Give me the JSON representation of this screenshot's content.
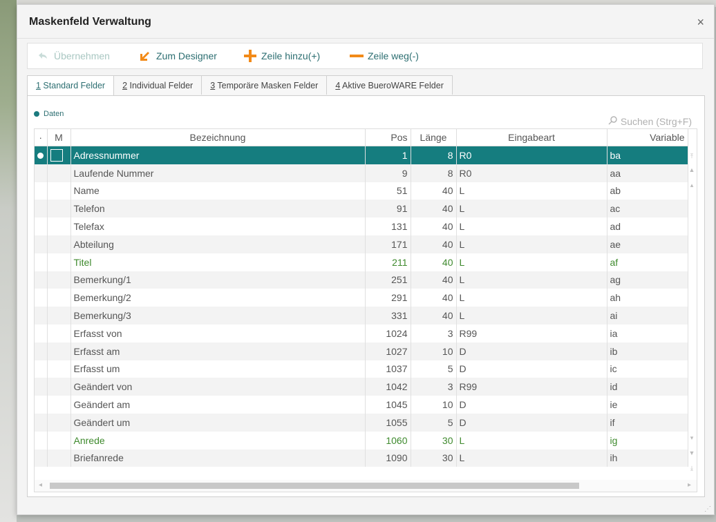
{
  "dialog": {
    "title": "Maskenfeld Verwaltung",
    "close_label": "×"
  },
  "toolbar": {
    "uebernehmen": "Übernehmen",
    "zum_designer": "Zum Designer",
    "zeile_hinzu": "Zeile hinzu(+)",
    "zeile_weg": "Zeile weg(-)"
  },
  "tabs": [
    {
      "num": "1",
      "label": " Standard Felder"
    },
    {
      "num": "2",
      "label": " Individual Felder"
    },
    {
      "num": "3",
      "label": " Temporäre Masken Felder"
    },
    {
      "num": "4",
      "label": " Aktive BueroWARE Felder"
    }
  ],
  "section_label": "Daten",
  "search_label": "Suchen (Strg+F)",
  "columns": {
    "dot": "·",
    "m": "M",
    "bezeichnung": "Bezeichnung",
    "pos": "Pos",
    "laenge": "Länge",
    "eingabeart": "Eingabeart",
    "variable": "Variable"
  },
  "rows": [
    {
      "bezeichnung": "Adressnummer",
      "pos": "1",
      "laenge": "8",
      "eingabeart": "R0",
      "variable": "ba",
      "selected": true
    },
    {
      "bezeichnung": "Laufende Nummer",
      "pos": "9",
      "laenge": "8",
      "eingabeart": "R0",
      "variable": "aa"
    },
    {
      "bezeichnung": "Name",
      "pos": "51",
      "laenge": "40",
      "eingabeart": "L",
      "variable": "ab"
    },
    {
      "bezeichnung": "Telefon",
      "pos": "91",
      "laenge": "40",
      "eingabeart": "L",
      "variable": "ac"
    },
    {
      "bezeichnung": "Telefax",
      "pos": "131",
      "laenge": "40",
      "eingabeart": "L",
      "variable": "ad"
    },
    {
      "bezeichnung": "Abteilung",
      "pos": "171",
      "laenge": "40",
      "eingabeart": "L",
      "variable": "ae"
    },
    {
      "bezeichnung": "Titel",
      "pos": "211",
      "laenge": "40",
      "eingabeart": "L",
      "variable": "af",
      "green": true
    },
    {
      "bezeichnung": "Bemerkung/1",
      "pos": "251",
      "laenge": "40",
      "eingabeart": "L",
      "variable": "ag"
    },
    {
      "bezeichnung": "Bemerkung/2",
      "pos": "291",
      "laenge": "40",
      "eingabeart": "L",
      "variable": "ah"
    },
    {
      "bezeichnung": "Bemerkung/3",
      "pos": "331",
      "laenge": "40",
      "eingabeart": "L",
      "variable": "ai"
    },
    {
      "bezeichnung": "Erfasst von",
      "pos": "1024",
      "laenge": "3",
      "eingabeart": "R99",
      "variable": "ia"
    },
    {
      "bezeichnung": "Erfasst am",
      "pos": "1027",
      "laenge": "10",
      "eingabeart": "D",
      "variable": "ib"
    },
    {
      "bezeichnung": "Erfasst um",
      "pos": "1037",
      "laenge": "5",
      "eingabeart": "D",
      "variable": "ic"
    },
    {
      "bezeichnung": "Geändert von",
      "pos": "1042",
      "laenge": "3",
      "eingabeart": "R99",
      "variable": "id"
    },
    {
      "bezeichnung": "Geändert am",
      "pos": "1045",
      "laenge": "10",
      "eingabeart": "D",
      "variable": "ie"
    },
    {
      "bezeichnung": "Geändert um",
      "pos": "1055",
      "laenge": "5",
      "eingabeart": "D",
      "variable": "if"
    },
    {
      "bezeichnung": "Anrede",
      "pos": "1060",
      "laenge": "30",
      "eingabeart": "L",
      "variable": "ig",
      "green": true
    },
    {
      "bezeichnung": "Briefanrede",
      "pos": "1090",
      "laenge": "30",
      "eingabeart": "L",
      "variable": "ih"
    }
  ],
  "colors": {
    "accent": "#157d7f",
    "orange": "#f28a18",
    "green_text": "#3f8a2e"
  }
}
